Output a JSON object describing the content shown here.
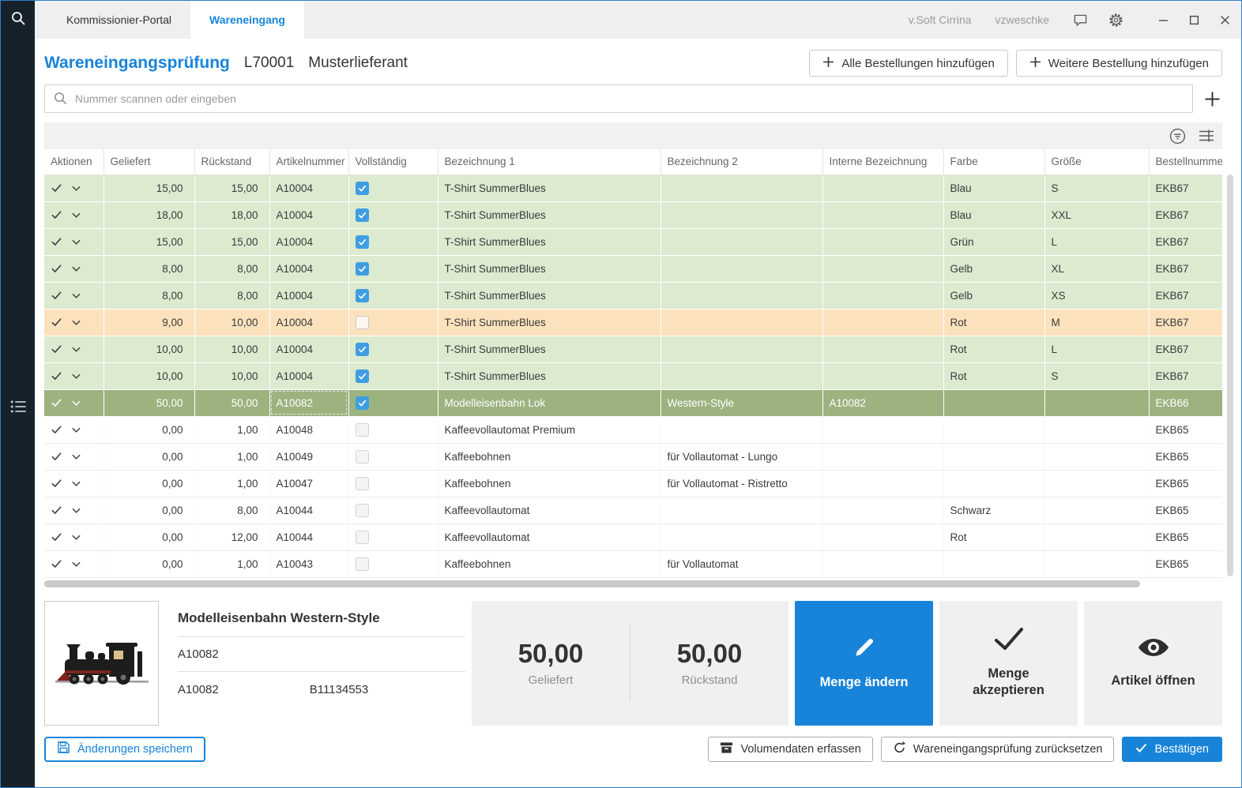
{
  "titlebar": {
    "tabs": [
      {
        "label": "Kommissionier-Portal",
        "active": false
      },
      {
        "label": "Wareneingang",
        "active": true
      }
    ],
    "app_label": "v.Soft Cirrina",
    "user": "vzweschke"
  },
  "header": {
    "title": "Wareneingangsprüfung",
    "supplier_code": "L70001",
    "supplier_name": "Musterlieferant",
    "buttons": {
      "add_all": "Alle Bestellungen hinzufügen",
      "add_one": "Weitere Bestellung hinzufügen"
    }
  },
  "search": {
    "placeholder": "Nummer scannen oder eingeben"
  },
  "table": {
    "columns": [
      "Aktionen",
      "Geliefert",
      "Rückstand",
      "Artikelnummer",
      "Vollständig",
      "Bezeichnung 1",
      "Bezeichnung 2",
      "Interne Bezeichnung",
      "Farbe",
      "Größe",
      "Bestellnummer"
    ],
    "rows": [
      {
        "geliefert": "15,00",
        "rueckstand": "15,00",
        "artikel": "A10004",
        "complete": true,
        "bez1": "T-Shirt SummerBlues",
        "bez2": "",
        "intern": "",
        "farbe": "Blau",
        "groesse": "S",
        "bestellnr": "EKB67",
        "state": "green"
      },
      {
        "geliefert": "18,00",
        "rueckstand": "18,00",
        "artikel": "A10004",
        "complete": true,
        "bez1": "T-Shirt SummerBlues",
        "bez2": "",
        "intern": "",
        "farbe": "Blau",
        "groesse": "XXL",
        "bestellnr": "EKB67",
        "state": "green"
      },
      {
        "geliefert": "15,00",
        "rueckstand": "15,00",
        "artikel": "A10004",
        "complete": true,
        "bez1": "T-Shirt SummerBlues",
        "bez2": "",
        "intern": "",
        "farbe": "Grün",
        "groesse": "L",
        "bestellnr": "EKB67",
        "state": "green"
      },
      {
        "geliefert": "8,00",
        "rueckstand": "8,00",
        "artikel": "A10004",
        "complete": true,
        "bez1": "T-Shirt SummerBlues",
        "bez2": "",
        "intern": "",
        "farbe": "Gelb",
        "groesse": "XL",
        "bestellnr": "EKB67",
        "state": "green"
      },
      {
        "geliefert": "8,00",
        "rueckstand": "8,00",
        "artikel": "A10004",
        "complete": true,
        "bez1": "T-Shirt SummerBlues",
        "bez2": "",
        "intern": "",
        "farbe": "Gelb",
        "groesse": "XS",
        "bestellnr": "EKB67",
        "state": "green"
      },
      {
        "geliefert": "9,00",
        "rueckstand": "10,00",
        "artikel": "A10004",
        "complete": false,
        "bez1": "T-Shirt SummerBlues",
        "bez2": "",
        "intern": "",
        "farbe": "Rot",
        "groesse": "M",
        "bestellnr": "EKB67",
        "state": "orange"
      },
      {
        "geliefert": "10,00",
        "rueckstand": "10,00",
        "artikel": "A10004",
        "complete": true,
        "bez1": "T-Shirt SummerBlues",
        "bez2": "",
        "intern": "",
        "farbe": "Rot",
        "groesse": "L",
        "bestellnr": "EKB67",
        "state": "green"
      },
      {
        "geliefert": "10,00",
        "rueckstand": "10,00",
        "artikel": "A10004",
        "complete": true,
        "bez1": "T-Shirt SummerBlues",
        "bez2": "",
        "intern": "",
        "farbe": "Rot",
        "groesse": "S",
        "bestellnr": "EKB67",
        "state": "green"
      },
      {
        "geliefert": "50,00",
        "rueckstand": "50,00",
        "artikel": "A10082",
        "complete": true,
        "bez1": "Modelleisenbahn Lok",
        "bez2": "Western-Style",
        "intern": "A10082",
        "farbe": "",
        "groesse": "",
        "bestellnr": "EKB66",
        "state": "selected"
      },
      {
        "geliefert": "0,00",
        "rueckstand": "1,00",
        "artikel": "A10048",
        "complete": false,
        "bez1": "Kaffeevollautomat Premium",
        "bez2": "",
        "intern": "",
        "farbe": "",
        "groesse": "",
        "bestellnr": "EKB65",
        "state": "white"
      },
      {
        "geliefert": "0,00",
        "rueckstand": "1,00",
        "artikel": "A10049",
        "complete": false,
        "bez1": "Kaffeebohnen",
        "bez2": "für Vollautomat - Lungo",
        "intern": "",
        "farbe": "",
        "groesse": "",
        "bestellnr": "EKB65",
        "state": "white"
      },
      {
        "geliefert": "0,00",
        "rueckstand": "1,00",
        "artikel": "A10047",
        "complete": false,
        "bez1": "Kaffeebohnen",
        "bez2": "für Vollautomat - Ristretto",
        "intern": "",
        "farbe": "",
        "groesse": "",
        "bestellnr": "EKB65",
        "state": "white"
      },
      {
        "geliefert": "0,00",
        "rueckstand": "8,00",
        "artikel": "A10044",
        "complete": false,
        "bez1": "Kaffeevollautomat",
        "bez2": "",
        "intern": "",
        "farbe": "Schwarz",
        "groesse": "",
        "bestellnr": "EKB65",
        "state": "white"
      },
      {
        "geliefert": "0,00",
        "rueckstand": "12,00",
        "artikel": "A10044",
        "complete": false,
        "bez1": "Kaffeevollautomat",
        "bez2": "",
        "intern": "",
        "farbe": "Rot",
        "groesse": "",
        "bestellnr": "EKB65",
        "state": "white"
      },
      {
        "geliefert": "0,00",
        "rueckstand": "1,00",
        "artikel": "A10043",
        "complete": false,
        "bez1": "Kaffeebohnen",
        "bez2": "für Vollautomat",
        "intern": "",
        "farbe": "",
        "groesse": "",
        "bestellnr": "EKB65",
        "state": "white"
      }
    ]
  },
  "detail": {
    "product_title": "Modelleisenbahn Western-Style",
    "article_number": "A10082",
    "code_left": "A10082",
    "code_right": "B11134553",
    "geliefert_value": "50,00",
    "geliefert_label": "Geliefert",
    "rueckstand_value": "50,00",
    "rueckstand_label": "Rückstand",
    "buttons": {
      "change_qty": "Menge ändern",
      "accept_qty": "Menge akzeptieren",
      "open_article": "Artikel öffnen"
    }
  },
  "footer": {
    "save": "Änderungen speichern",
    "volume": "Volumendaten erfassen",
    "reset": "Wareneingangsprüfung zurücksetzen",
    "confirm": "Bestätigen"
  },
  "icons": [
    "search-icon",
    "feedback-icon",
    "gear-icon",
    "minimize-icon",
    "maximize-icon",
    "close-icon",
    "filter-icon",
    "column-options-icon",
    "plus-icon",
    "check-icon",
    "chevron-down-icon",
    "pencil-icon",
    "eye-icon",
    "save-icon",
    "archive-icon",
    "reset-icon",
    "list-menu-icon"
  ],
  "colors": {
    "accent": "#1884d9",
    "row_complete": "#dcead0",
    "row_incomplete": "#fbe2bd",
    "row_selected": "#9cb380",
    "sidebar": "#17212b",
    "checkbox_checked": "#3f9ee2"
  }
}
